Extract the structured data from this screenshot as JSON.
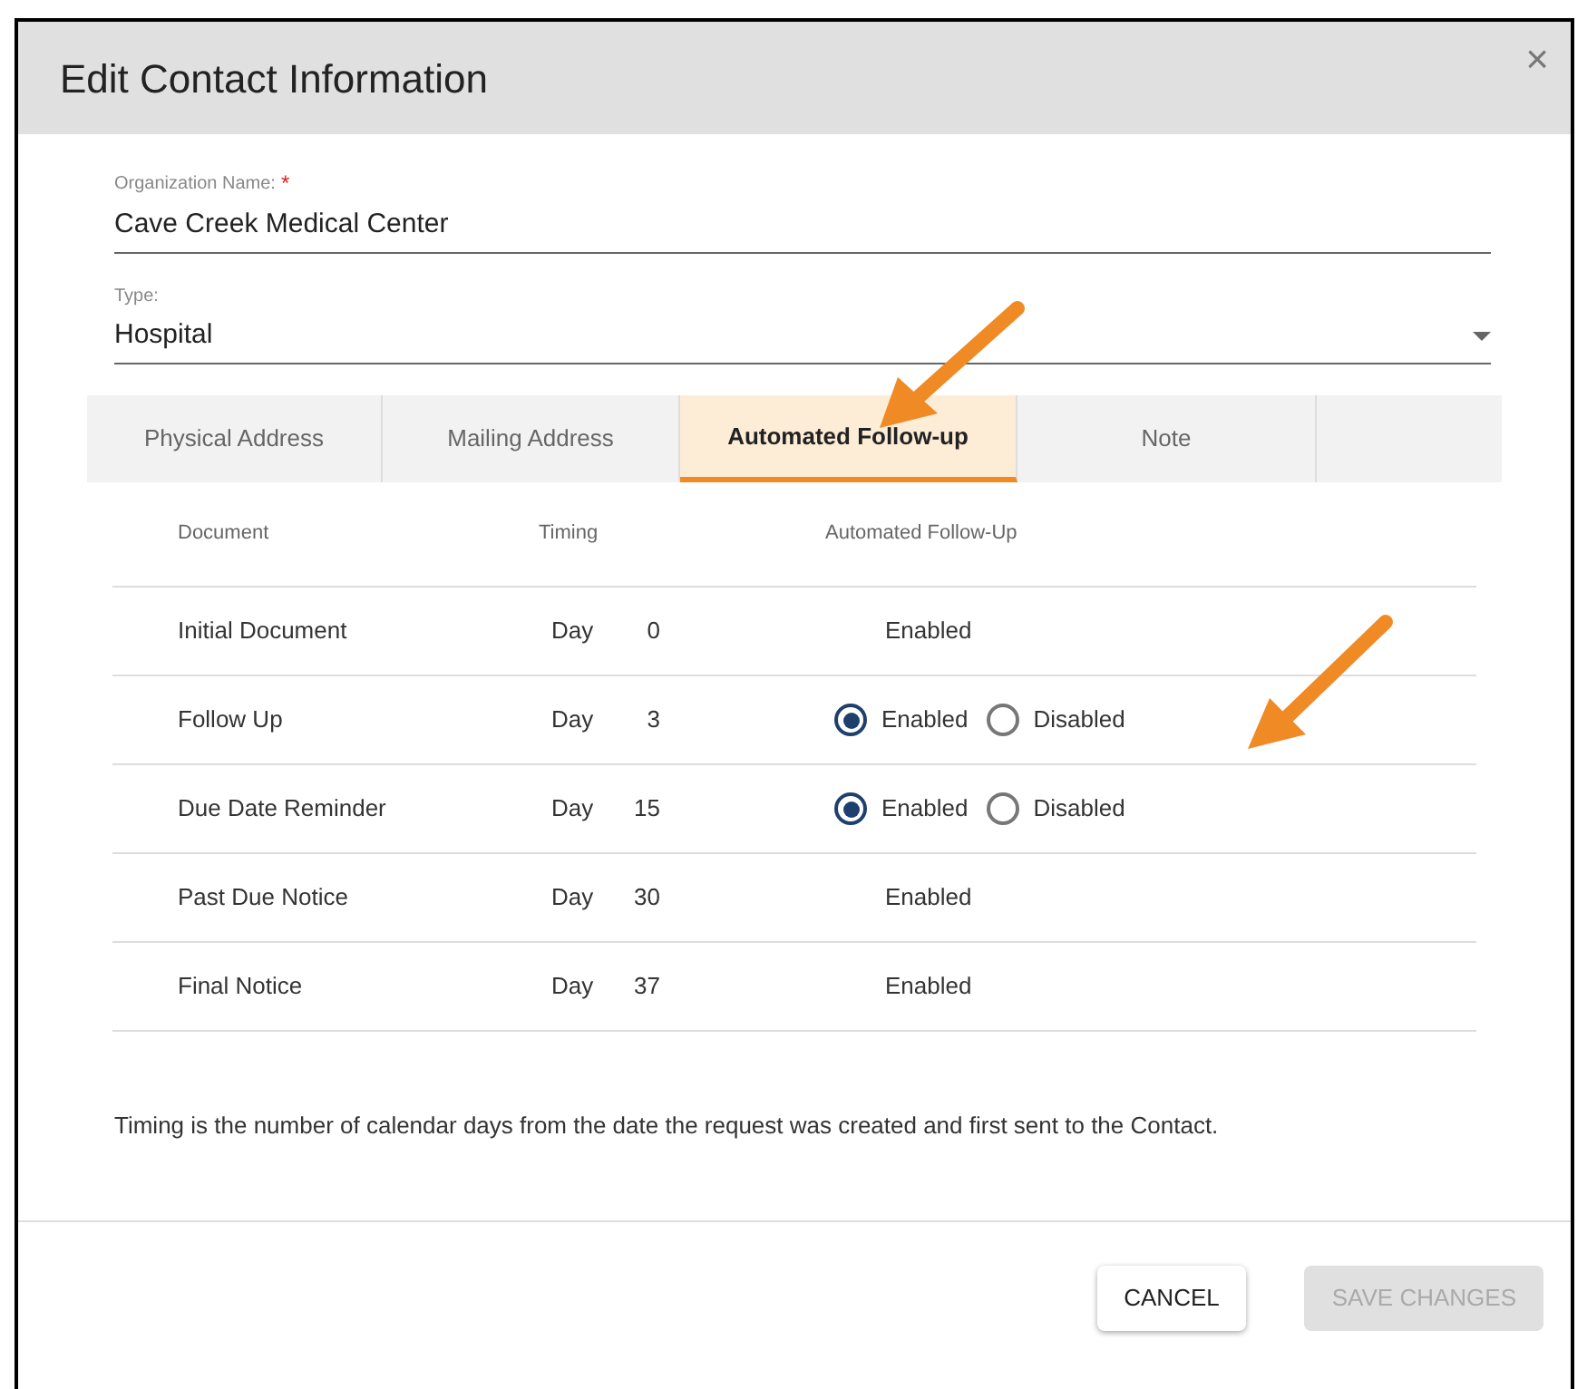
{
  "dialog": {
    "title": "Edit Contact Information",
    "close": "×"
  },
  "fields": [
    {
      "label": "Organization Name:",
      "required_mark": "*",
      "value": "Cave Creek Medical Center",
      "kind": "text"
    },
    {
      "label": "Type:",
      "value": "Hospital",
      "kind": "select"
    }
  ],
  "tabs": [
    {
      "label": "Physical Address",
      "selected": false
    },
    {
      "label": "Mailing Address",
      "selected": false
    },
    {
      "label": "Automated Follow-up",
      "selected": true
    },
    {
      "label": "Note",
      "selected": false
    }
  ],
  "table": {
    "columns": [
      "Document",
      "Timing",
      "Automated Follow-Up"
    ],
    "rows": [
      {
        "document": "Initial Document",
        "day_label": "Day",
        "day": "0",
        "kind": "static",
        "status": "Enabled"
      },
      {
        "document": "Follow Up",
        "day_label": "Day",
        "day": "3",
        "kind": "radio",
        "options": [
          {
            "label": "Enabled",
            "selected": true
          },
          {
            "label": "Disabled",
            "selected": false
          }
        ]
      },
      {
        "document": "Due Date Reminder",
        "day_label": "Day",
        "day": "15",
        "kind": "radio",
        "options": [
          {
            "label": "Enabled",
            "selected": true
          },
          {
            "label": "Disabled",
            "selected": false
          }
        ]
      },
      {
        "document": "Past Due Notice",
        "day_label": "Day",
        "day": "30",
        "kind": "static",
        "status": "Enabled"
      },
      {
        "document": "Final Notice",
        "day_label": "Day",
        "day": "37",
        "kind": "static",
        "status": "Enabled"
      }
    ]
  },
  "note": "Timing is the number of calendar days from the date the request was created and first sent to the Contact.",
  "buttons": [
    {
      "label": "CANCEL",
      "disabled": false
    },
    {
      "label": "SAVE CHANGES",
      "disabled": true
    }
  ]
}
